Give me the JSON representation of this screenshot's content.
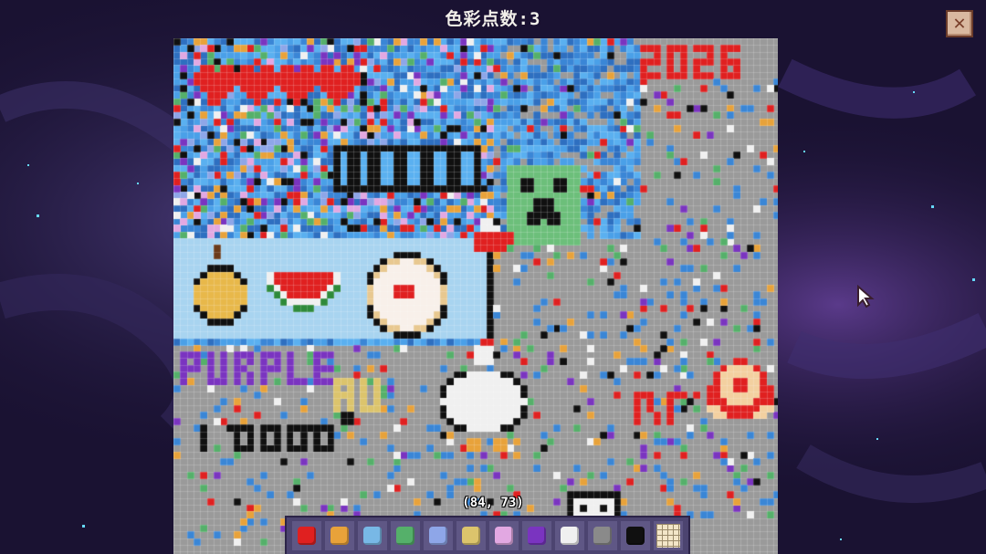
{
  "header": {
    "title": "色彩点数:3"
  },
  "cursor_readout": "(84, 73)",
  "close_icon": "close-icon",
  "canvas": {
    "year_text": "2026",
    "palette_colors_note": "art visible on canvas",
    "labels": [
      "PURPLE",
      "AU",
      "bbno"
    ]
  },
  "palette": {
    "colors": [
      "#e02020",
      "#e8a23a",
      "#78b8e6",
      "#55b06a",
      "#8ea6e8",
      "#dcc46c",
      "#e2a8e2",
      "#7a34c0",
      "#f0f0f0",
      "#8a8a8a",
      "#101010"
    ],
    "grid_icon": "grid-icon"
  }
}
